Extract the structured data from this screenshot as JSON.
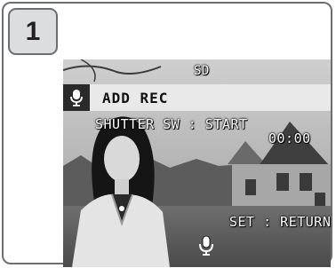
{
  "step": {
    "number": "1"
  },
  "screen": {
    "media": "SD",
    "mode_title": "ADD REC",
    "shutter_hint": "SHUTTER SW : START",
    "timer": "00:00",
    "set_hint": "SET : RETURN",
    "icons": {
      "title": "microphone-icon",
      "bottom": "microphone-icon"
    }
  },
  "colors": {
    "frame_border": "#6d6e71",
    "badge_fill": "#dcdddf",
    "title_bar": "#ececec",
    "osd_text": "#ffffff"
  }
}
